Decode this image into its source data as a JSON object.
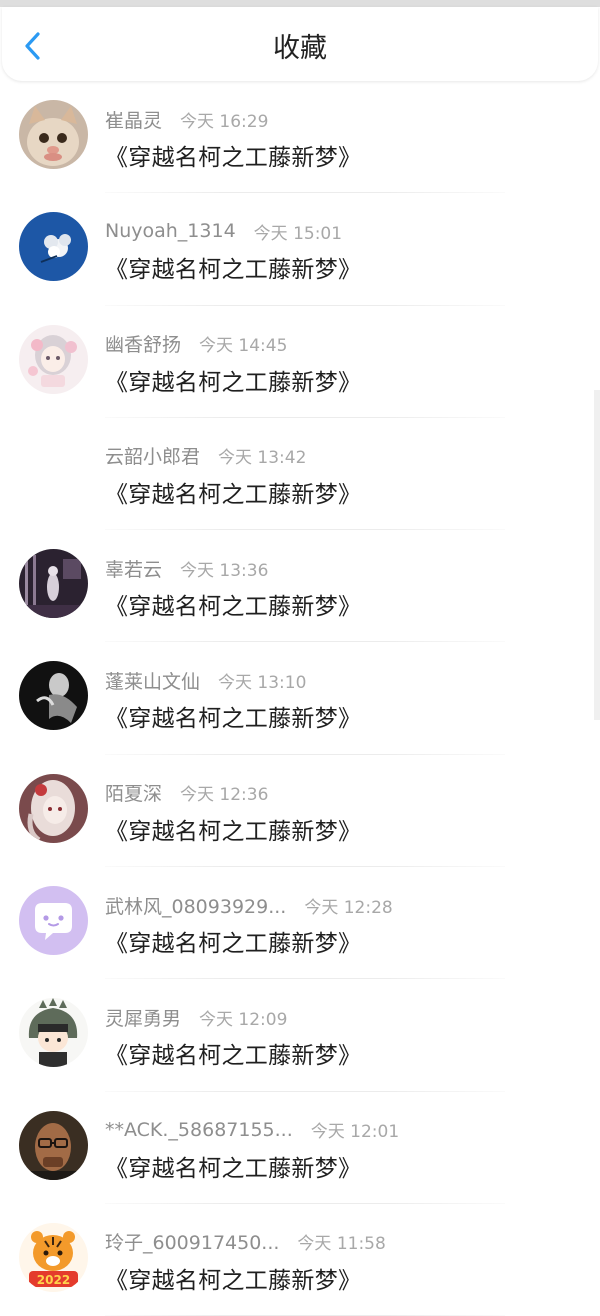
{
  "header": {
    "title": "收藏",
    "back_icon": "chevron-left-icon",
    "accent": "#2b9af3"
  },
  "items": [
    {
      "name": "崔晶灵",
      "time": "今天 16:29",
      "book": "《穿越名柯之工藤新梦》",
      "avatar": "cat"
    },
    {
      "name": "Nuyoah_1314",
      "time": "今天 15:01",
      "book": "《穿越名柯之工藤新梦》",
      "avatar": "flower-blue"
    },
    {
      "name": "幽香舒扬",
      "time": "今天 14:45",
      "book": "《穿越名柯之工藤新梦》",
      "avatar": "anime-girl"
    },
    {
      "name": "云韶小郎君",
      "time": "今天 13:42",
      "book": "《穿越名柯之工藤新梦》",
      "avatar": "none"
    },
    {
      "name": "辜若云",
      "time": "今天 13:36",
      "book": "《穿越名柯之工藤新梦》",
      "avatar": "dark-room"
    },
    {
      "name": "蓬莱山文仙",
      "time": "今天 13:10",
      "book": "《穿越名柯之工藤新梦》",
      "avatar": "bw-person"
    },
    {
      "name": "陌夏深",
      "time": "今天 12:36",
      "book": "《穿越名柯之工藤新梦》",
      "avatar": "anime-red"
    },
    {
      "name": "武林风_08093929...",
      "time": "今天 12:28",
      "book": "《穿越名柯之工藤新梦》",
      "avatar": "chat-bubble"
    },
    {
      "name": "灵犀勇男",
      "time": "今天 12:09",
      "book": "《穿越名柯之工藤新梦》",
      "avatar": "dino-girl"
    },
    {
      "name": "**ACK._58687155...",
      "time": "今天 12:01",
      "book": "《穿越名柯之工藤新梦》",
      "avatar": "man-glasses"
    },
    {
      "name": "玲子_600917450...",
      "time": "今天 11:58",
      "book": "《穿越名柯之工藤新梦》",
      "avatar": "tiger-2022",
      "avatar_text": "2022"
    }
  ]
}
